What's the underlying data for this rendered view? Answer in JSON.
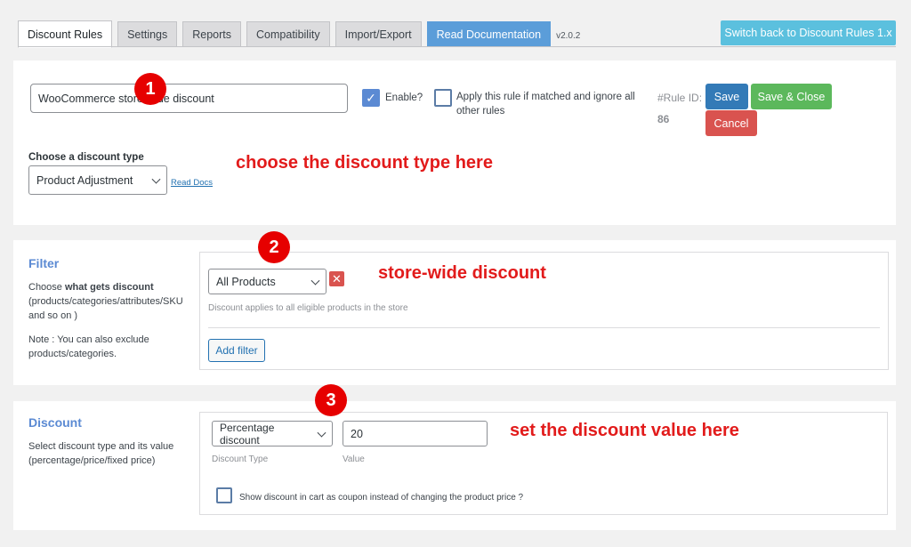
{
  "tabs": [
    {
      "label": "Discount Rules"
    },
    {
      "label": "Settings"
    },
    {
      "label": "Reports"
    },
    {
      "label": "Compatibility"
    },
    {
      "label": "Import/Export"
    },
    {
      "label": "Read Documentation"
    }
  ],
  "version": "v2.0.2",
  "switch_button": "Switch back to Discount Rules 1.x",
  "rule": {
    "name": "WooCommerce store-wide discount",
    "enable_label": "Enable?",
    "enable_checked": true,
    "apply_label": "Apply this rule if matched and ignore all other rules",
    "apply_checked": false,
    "rule_id_label": "#Rule ID:",
    "rule_id_value": "86",
    "save_label": "Save",
    "save_close_label": "Save & Close",
    "cancel_label": "Cancel",
    "discount_type_label": "Choose a discount type",
    "discount_type_value": "Product Adjustment",
    "read_docs": "Read Docs"
  },
  "filter": {
    "title": "Filter",
    "desc_prefix": "Choose ",
    "desc_bold": "what gets discount",
    "desc_suffix": "(products/categories/attributes/SKU and so on )",
    "note": "Note : You can also exclude products/categories.",
    "select_value": "All Products",
    "help": "Discount applies to all eligible products in the store",
    "add_filter": "Add filter"
  },
  "discount": {
    "title": "Discount",
    "desc": "Select discount type and its value (percentage/price/fixed price)",
    "type_value": "Percentage discount",
    "value": "20",
    "type_label": "Discount Type",
    "value_label": "Value",
    "coupon_label": "Show discount in cart as coupon instead of changing the product price ?"
  },
  "annotations": {
    "badge1": "1",
    "badge2": "2",
    "badge3": "3",
    "text1": "choose the discount type here",
    "text2": "store-wide discount",
    "text3": "set the discount value here"
  },
  "colors": {
    "accent": "#5b8ad3",
    "save": "#337ab7",
    "save_close": "#5cb85c",
    "cancel": "#d9534f",
    "annotation": "#e21b1b"
  }
}
